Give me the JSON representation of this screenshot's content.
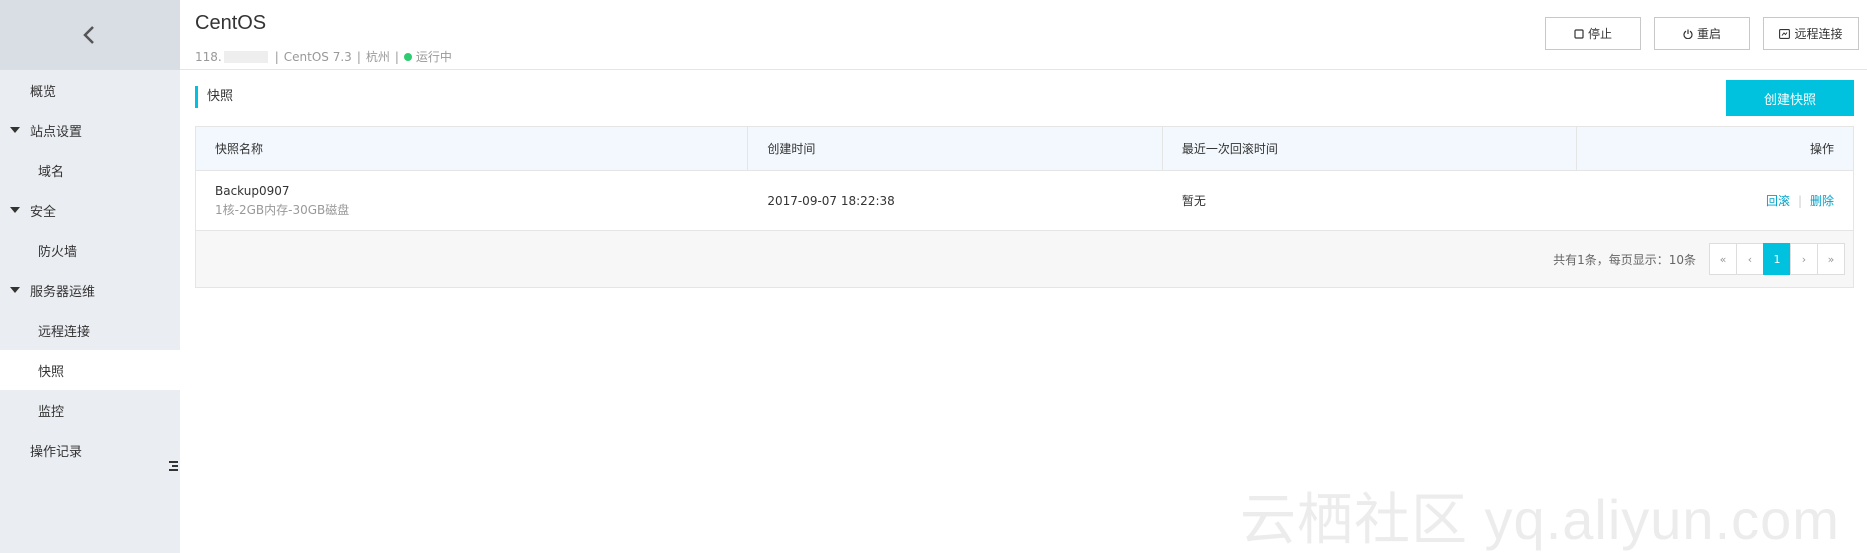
{
  "sidebar": {
    "items": [
      {
        "label": "概览"
      },
      {
        "label": "站点设置"
      },
      {
        "label": "域名"
      },
      {
        "label": "安全"
      },
      {
        "label": "防火墙"
      },
      {
        "label": "服务器运维"
      },
      {
        "label": "远程连接"
      },
      {
        "label": "快照"
      },
      {
        "label": "监控"
      },
      {
        "label": "操作记录"
      }
    ]
  },
  "header": {
    "title": "CentOS",
    "ip_prefix": "118.",
    "os": "CentOS 7.3",
    "region": "杭州",
    "status": "运行中",
    "sep": "|",
    "status_color": "#2ecc71",
    "buttons": {
      "stop": "停止",
      "restart": "重启",
      "remote": "远程连接"
    }
  },
  "section": {
    "title": "快照",
    "create_button": "创建快照",
    "accent": "#00c1de"
  },
  "table": {
    "columns": [
      "快照名称",
      "创建时间",
      "最近一次回滚时间",
      "操作"
    ],
    "rows": [
      {
        "name": "Backup0907",
        "spec": "1核-2GB内存-30GB磁盘",
        "created": "2017-09-07 18:22:38",
        "last_rollback": "暂无",
        "actions": {
          "rollback": "回滚",
          "sep": "|",
          "delete": "删除"
        }
      }
    ]
  },
  "pagination": {
    "info": "共有1条，每页显示：10条",
    "first": "«",
    "prev": "‹",
    "current": "1",
    "next": "›",
    "last": "»"
  },
  "watermark": "云栖社区 yq.aliyun.com"
}
